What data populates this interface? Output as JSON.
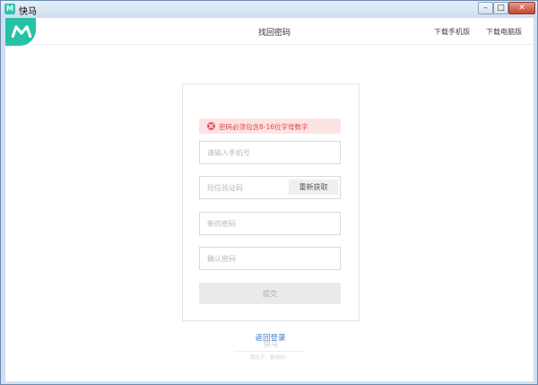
{
  "window": {
    "title": "快马",
    "app_icon": "快马-logo-icon",
    "controls": {
      "minimize": "–",
      "maximize": "□",
      "close": "✕"
    }
  },
  "header": {
    "title": "找回密码",
    "links": {
      "mobile": "下载手机版",
      "pc": "下载电脑版"
    },
    "logo": "m-logo",
    "accent_color": "#26c2a6"
  },
  "form": {
    "error_message": "密码必须包含8-16位字母数字",
    "error_color": "#e04446",
    "phone_placeholder": "请输入手机号",
    "code_placeholder": "短信验证码",
    "resend_label": "重新获取",
    "new_password_placeholder": "新的密码",
    "confirm_password_placeholder": "确认密码",
    "submit_label": "提交"
  },
  "footer": {
    "back_login": "返回登录",
    "brand": "快马",
    "tagline": "我在乎，更相知！"
  }
}
